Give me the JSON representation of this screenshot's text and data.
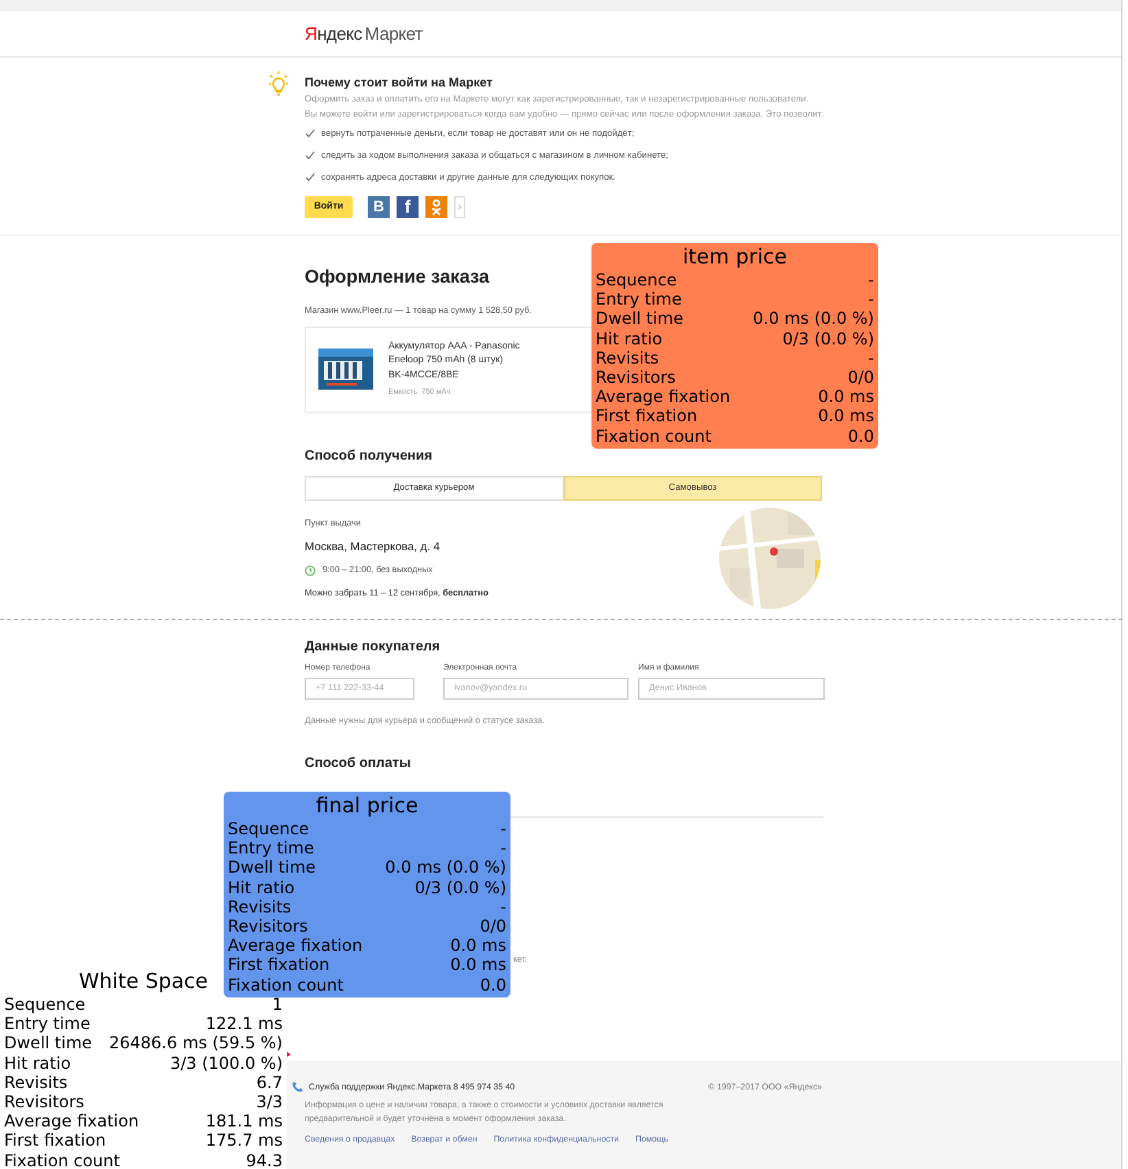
{
  "logo": {
    "brand": "Яндекс",
    "product": "Маркет"
  },
  "promo": {
    "title": "Почему стоит войти на Маркет",
    "lines": [
      "Оформить заказ и оплатить его на Маркете могут как зарегистрированные, так и незарегистрированные пользователи.",
      "Вы можете войти или зарегистрироваться когда вам удобно — прямо сейчас или после оформления заказа. Это позволит:"
    ],
    "benefits": [
      "вернуть потраченные деньги, если товар не доставят или он не подойдёт;",
      "следить за ходом выполнения заказа и общаться с магазином в личном кабинете;",
      "сохранять адреса доставки и другие данные для следующих покупок."
    ],
    "login_button": "Войти",
    "social": [
      {
        "kind": "vk",
        "text": "В"
      },
      {
        "kind": "facebook",
        "text": "f"
      },
      {
        "kind": "ok"
      },
      {
        "kind": "more",
        "text": "›"
      }
    ]
  },
  "order": {
    "title": "Оформление заказа",
    "summary": "Магазин www.Pleer.ru — 1 товар на сумму 1 528,50 руб.",
    "product": {
      "name_lines": [
        "Аккумулятор AAA - Panasonic",
        "Eneloop 750 mAh (8 штук)",
        "BK-4MCCE/8BE"
      ],
      "spec": "Емкость: 750 мАч"
    }
  },
  "delivery": {
    "title": "Способ получения",
    "tabs": [
      {
        "label": "Доставка курьером",
        "selected": false
      },
      {
        "label": "Самовывоз",
        "selected": true
      }
    ],
    "pickup_label": "Пункт выдачи",
    "address": "Москва, Мастеркова, д. 4",
    "hours": "9:00 – 21:00, без выходных",
    "availability": "Можно забрать 11 – 12 сентября, **бесплатно**"
  },
  "buyer": {
    "title": "Данные покупателя",
    "fields": [
      {
        "label": "Номер телефона",
        "placeholder": "+7 111 222-33-44"
      },
      {
        "label": "Электронная почта",
        "placeholder": "ivanov@yandex.ru"
      },
      {
        "label": "Имя и фамилия",
        "placeholder": "Денис Иванов"
      }
    ],
    "note": "Данные нужны для курьера и сообщений о статусе заказа."
  },
  "payment": {
    "title": "Способ оплаты",
    "visible_text": "кет."
  },
  "footer": {
    "support": "Служба поддержки Яндекс.Маркета 8 495 974 35 40",
    "copyright": "© 1997–2017 ООО «Яндекс»",
    "info_lines": [
      "Информация о цене и наличии товара, а также о стоимости и условиях доставки является",
      "предварительной и будет уточнена в момент оформления заказа."
    ],
    "links": [
      "Сведения о продавцах",
      "Возврат и обмен",
      "Политика конфиденциальности",
      "Помощь"
    ]
  },
  "aois": [
    {
      "title": "item price",
      "color": "#ff7f50",
      "metrics": [
        {
          "label": "Sequence",
          "value": "-"
        },
        {
          "label": "Entry time",
          "value": "-"
        },
        {
          "label": "Dwell time",
          "value": "0.0 ms (0.0 %)"
        },
        {
          "label": "Hit ratio",
          "value": "0/3 (0.0 %)"
        },
        {
          "label": "Revisits",
          "value": "-"
        },
        {
          "label": "Revisitors",
          "value": "0/0"
        },
        {
          "label": "Average fixation",
          "value": "0.0 ms"
        },
        {
          "label": "First fixation",
          "value": "0.0 ms"
        },
        {
          "label": "Fixation count",
          "value": "0.0"
        }
      ]
    },
    {
      "title": "final price",
      "color": "#6495ed",
      "metrics": [
        {
          "label": "Sequence",
          "value": "-"
        },
        {
          "label": "Entry time",
          "value": "-"
        },
        {
          "label": "Dwell time",
          "value": "0.0 ms (0.0 %)"
        },
        {
          "label": "Hit ratio",
          "value": "0/3 (0.0 %)"
        },
        {
          "label": "Revisits",
          "value": "-"
        },
        {
          "label": "Revisitors",
          "value": "0/0"
        },
        {
          "label": "Average fixation",
          "value": "0.0 ms"
        },
        {
          "label": "First fixation",
          "value": "0.0 ms"
        },
        {
          "label": "Fixation count",
          "value": "0.0"
        }
      ]
    },
    {
      "title": "White Space",
      "color": "#ffffff",
      "metrics": [
        {
          "label": "Sequence",
          "value": "1"
        },
        {
          "label": "Entry time",
          "value": "122.1 ms"
        },
        {
          "label": "Dwell time",
          "value": "26486.6 ms (59.5 %)"
        },
        {
          "label": "Hit ratio",
          "value": "3/3 (100.0 %)"
        },
        {
          "label": "Revisits",
          "value": "6.7"
        },
        {
          "label": "Revisitors",
          "value": "3/3"
        },
        {
          "label": "Average fixation",
          "value": "181.1 ms"
        },
        {
          "label": "First fixation",
          "value": "175.7 ms"
        },
        {
          "label": "Fixation count",
          "value": "94.3"
        }
      ]
    }
  ]
}
